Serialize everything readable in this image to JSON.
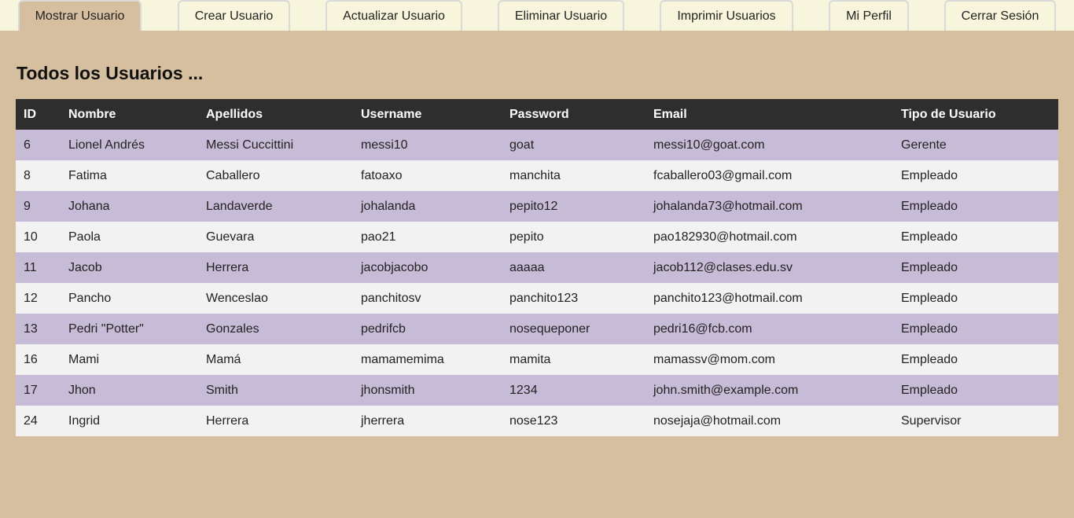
{
  "tabs": [
    {
      "label": "Mostrar Usuario",
      "active": true
    },
    {
      "label": "Crear Usuario"
    },
    {
      "label": "Actualizar Usuario"
    },
    {
      "label": "Eliminar Usuario"
    },
    {
      "label": "Imprimir Usuarios"
    },
    {
      "label": "Mi Perfil"
    },
    {
      "label": "Cerrar Sesión"
    }
  ],
  "page_title": "Todos los Usuarios ...",
  "table": {
    "headers": [
      "ID",
      "Nombre",
      "Apellidos",
      "Username",
      "Password",
      "Email",
      "Tipo de Usuario"
    ],
    "rows": [
      [
        "6",
        "Lionel Andrés",
        "Messi Cuccittini",
        "messi10",
        "goat",
        "messi10@goat.com",
        "Gerente"
      ],
      [
        "8",
        "Fatima",
        "Caballero",
        "fatoaxo",
        "manchita",
        "fcaballero03@gmail.com",
        "Empleado"
      ],
      [
        "9",
        "Johana",
        "Landaverde",
        "johalanda",
        "pepito12",
        "johalanda73@hotmail.com",
        "Empleado"
      ],
      [
        "10",
        "Paola",
        "Guevara",
        "pao21",
        "pepito",
        "pao182930@hotmail.com",
        "Empleado"
      ],
      [
        "11",
        "Jacob",
        "Herrera",
        "jacobjacobo",
        "aaaaa",
        "jacob112@clases.edu.sv",
        "Empleado"
      ],
      [
        "12",
        "Pancho",
        "Wenceslao",
        "panchitosv",
        "panchito123",
        "panchito123@hotmail.com",
        "Empleado"
      ],
      [
        "13",
        "Pedri \"Potter\"",
        "Gonzales",
        "pedrifcb",
        "nosequeponer",
        "pedri16@fcb.com",
        "Empleado"
      ],
      [
        "16",
        "Mami",
        "Mamá",
        "mamamemima",
        "mamita",
        "mamassv@mom.com",
        "Empleado"
      ],
      [
        "17",
        "Jhon",
        "Smith",
        "jhonsmith",
        "1234",
        "john.smith@example.com",
        "Empleado"
      ],
      [
        "24",
        "Ingrid",
        "Herrera",
        "jherrera",
        "nose123",
        "nosejaja@hotmail.com",
        "Supervisor"
      ]
    ]
  }
}
